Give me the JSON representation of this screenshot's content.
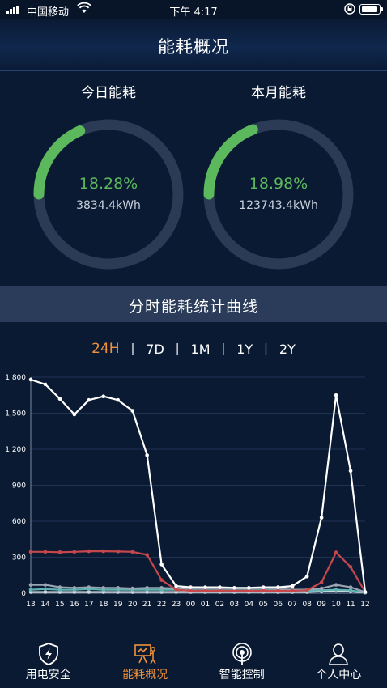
{
  "status_bar": {
    "carrier": "中国移动",
    "time": "下午 4:17",
    "icons": [
      "signal-icon",
      "wifi-icon",
      "rotation-lock-icon",
      "battery-icon"
    ]
  },
  "header": {
    "title": "能耗概况"
  },
  "gauges": [
    {
      "label": "今日能耗",
      "percent_text": "18.28%",
      "percent_value": 18.28,
      "energy": "3834.4kWh"
    },
    {
      "label": "本月能耗",
      "percent_text": "18.98%",
      "percent_value": 18.98,
      "energy": "123743.4kWh"
    }
  ],
  "section": {
    "title": "分时能耗统计曲线"
  },
  "range_tabs": {
    "items": [
      "24H",
      "7D",
      "1M",
      "1Y",
      "2Y"
    ],
    "selected": "24H",
    "separator": "|"
  },
  "colors": {
    "background": "#0b1a33",
    "gauge_fill": "#5cb85c",
    "gauge_track": "#2b3b55",
    "accent": "#f0923a",
    "series_white": "#ffffff",
    "series_red": "#c8474c",
    "series_cyan": "#5fb3b3",
    "series_gray": "#9aa6b2"
  },
  "chart_data": {
    "type": "line",
    "x": [
      "13",
      "14",
      "15",
      "16",
      "17",
      "18",
      "19",
      "20",
      "21",
      "22",
      "23",
      "00",
      "01",
      "02",
      "03",
      "04",
      "05",
      "06",
      "07",
      "08",
      "09",
      "10",
      "11",
      "12"
    ],
    "ylim": [
      0,
      1800
    ],
    "yticks": [
      "0",
      "300",
      "600",
      "900",
      "1,200",
      "1,500",
      "1,800"
    ],
    "ytick_values": [
      0,
      300,
      600,
      900,
      1200,
      1500,
      1800
    ],
    "grid": true,
    "series": [
      {
        "color": "#ffffff",
        "values": [
          1780,
          1740,
          1620,
          1490,
          1610,
          1640,
          1610,
          1520,
          1150,
          240,
          60,
          50,
          50,
          50,
          45,
          45,
          50,
          50,
          60,
          140,
          630,
          1650,
          1020,
          10
        ]
      },
      {
        "color": "#c8474c",
        "values": [
          345,
          345,
          342,
          345,
          350,
          350,
          348,
          345,
          320,
          110,
          30,
          20,
          20,
          20,
          20,
          20,
          20,
          20,
          20,
          25,
          90,
          340,
          220,
          10
        ]
      },
      {
        "color": "#9aa6b2",
        "values": [
          70,
          70,
          50,
          45,
          50,
          45,
          45,
          40,
          45,
          45,
          40,
          40,
          40,
          40,
          40,
          40,
          40,
          35,
          30,
          30,
          40,
          70,
          50,
          10
        ]
      },
      {
        "color": "#5fb3b3",
        "values": [
          30,
          35,
          30,
          30,
          35,
          30,
          30,
          30,
          30,
          30,
          30,
          25,
          25,
          25,
          25,
          25,
          25,
          25,
          20,
          20,
          25,
          30,
          25,
          5
        ]
      },
      {
        "color": "#cfd8dc",
        "values": [
          10,
          10,
          10,
          10,
          10,
          10,
          10,
          10,
          10,
          10,
          10,
          10,
          10,
          10,
          10,
          10,
          10,
          10,
          10,
          10,
          15,
          20,
          15,
          5
        ]
      }
    ]
  },
  "tabbar": {
    "items": [
      {
        "label": "用电安全",
        "icon": "shield-lightning-icon"
      },
      {
        "label": "能耗概况",
        "icon": "presentation-chart-icon"
      },
      {
        "label": "智能控制",
        "icon": "control-signal-icon"
      },
      {
        "label": "个人中心",
        "icon": "user-icon"
      }
    ],
    "selected_index": 1
  }
}
